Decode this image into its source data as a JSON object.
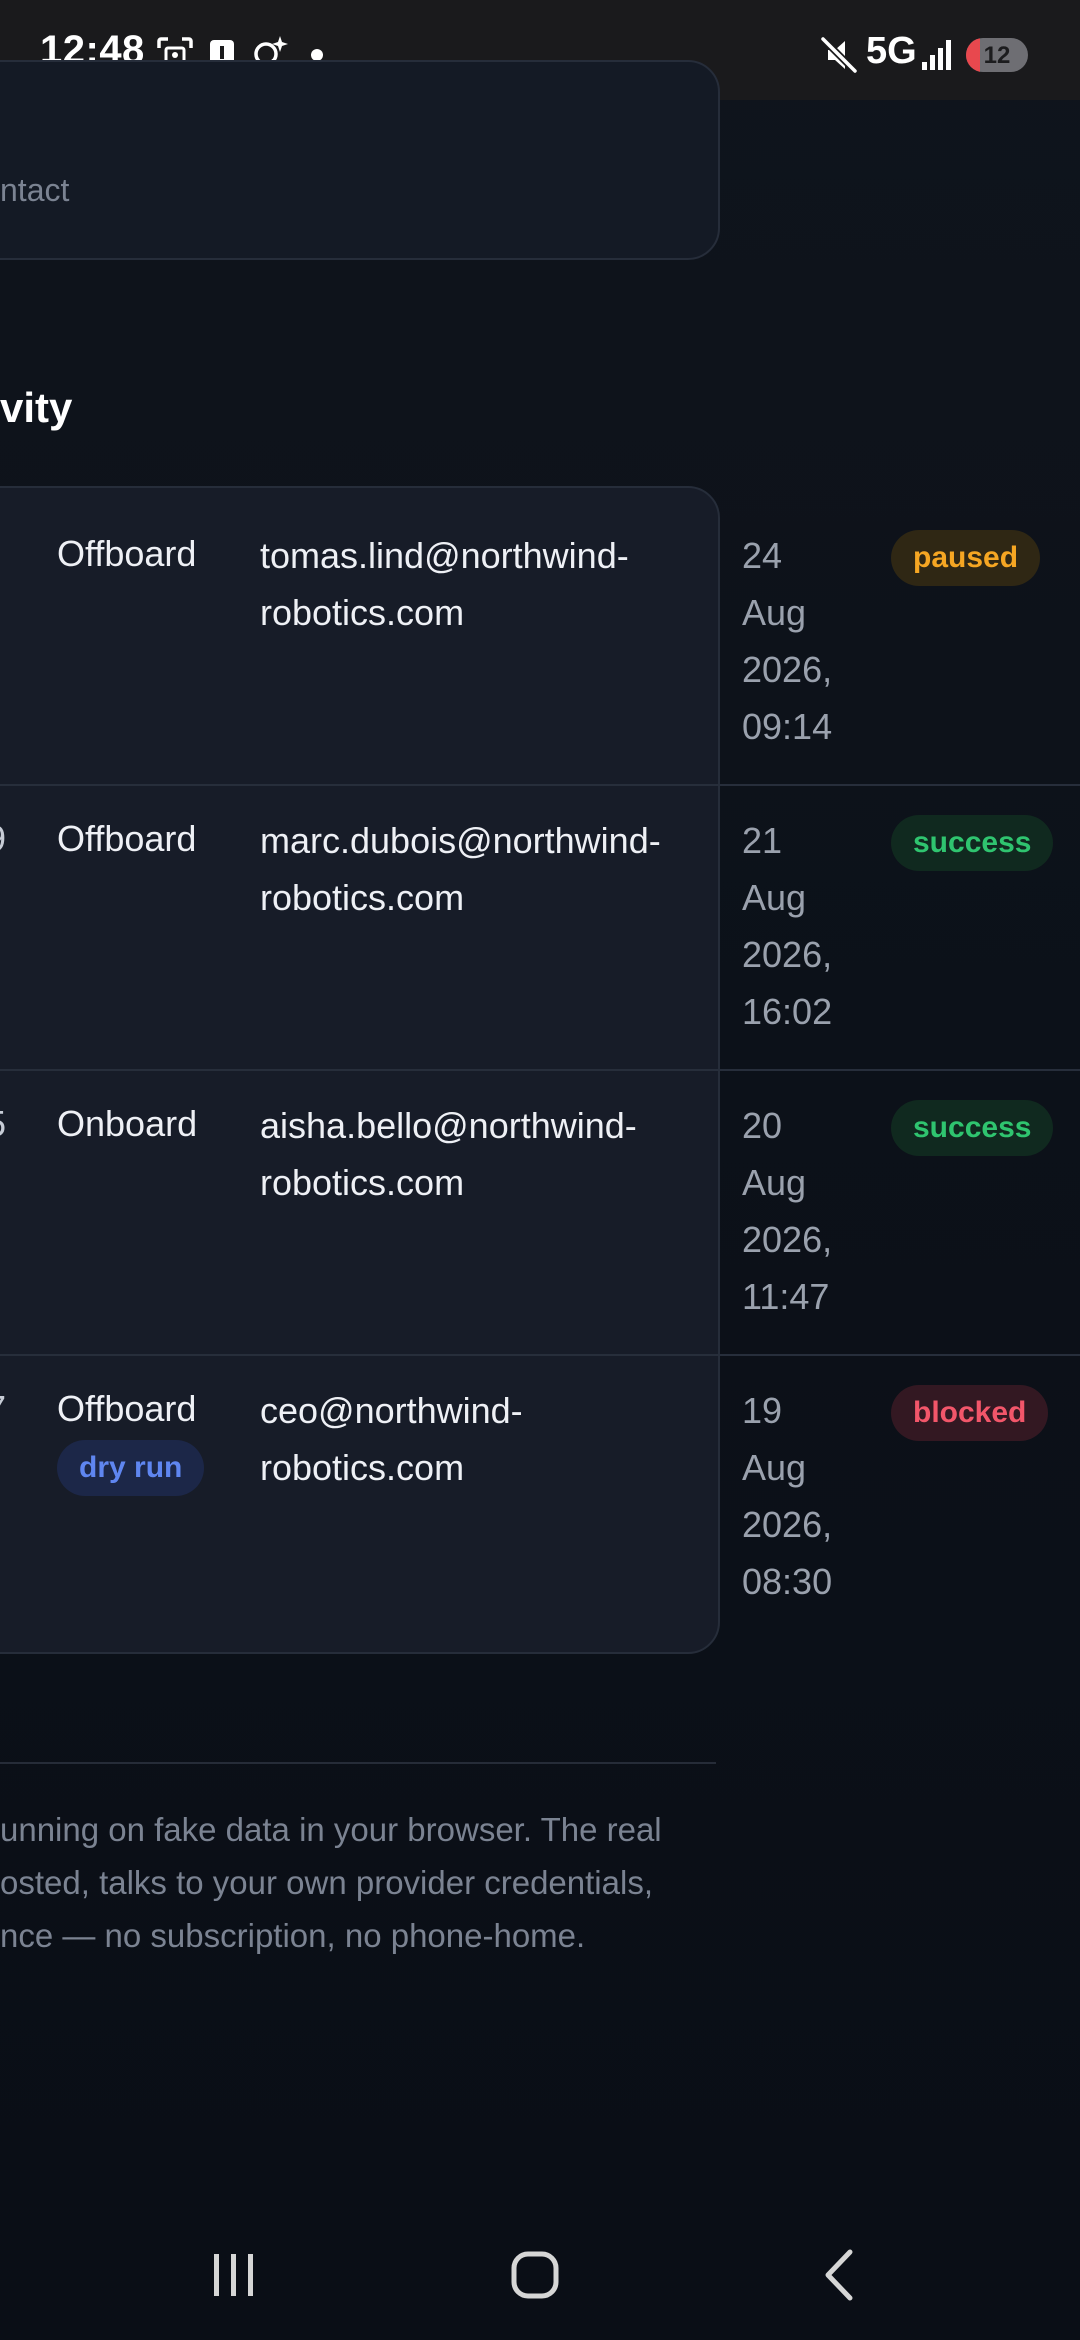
{
  "status_bar": {
    "time": "12:48",
    "network": "5G",
    "battery": "12",
    "icons": [
      "screenshot-icon",
      "alert-icon",
      "search-sparkle-icon",
      "notification-dot-icon",
      "mute-icon",
      "signal-icon"
    ]
  },
  "contact_card": {
    "text": "ntact"
  },
  "activity": {
    "heading": "vity",
    "rows": [
      {
        "num": "",
        "action": "Offboard",
        "email_line1": "tomas.lind@northwind-",
        "email_line2": "robotics.com",
        "date_day": "24",
        "date_month": "Aug",
        "date_year": "2026,",
        "date_time": "09:14",
        "status": "paused",
        "status_color": "#f5a623"
      },
      {
        "num": "9",
        "action": "Offboard",
        "email_line1": "marc.dubois@northwind-",
        "email_line2": "robotics.com",
        "date_day": "21",
        "date_month": "Aug",
        "date_year": "2026,",
        "date_time": "16:02",
        "status": "success",
        "status_color": "#2fc46f"
      },
      {
        "num": "5",
        "action": "Onboard",
        "email_line1": "aisha.bello@northwind-",
        "email_line2": "robotics.com",
        "date_day": "20",
        "date_month": "Aug",
        "date_year": "2026,",
        "date_time": "11:47",
        "status": "success",
        "status_color": "#2fc46f"
      },
      {
        "num": "7",
        "action": "Offboard",
        "dry_run": "dry run",
        "email_line1": "ceo@northwind-",
        "email_line2": "robotics.com",
        "date_day": "19",
        "date_month": "Aug",
        "date_year": "2026,",
        "date_time": "08:30",
        "status": "blocked",
        "status_color": "#f2566a"
      }
    ]
  },
  "footer": {
    "line1": "unning on fake data in your browser. The real",
    "line2": "osted, talks to your own provider credentials,",
    "line3": "nce — no subscription, no phone-home."
  },
  "nav_bar": {
    "buttons": [
      "recent-apps",
      "home",
      "back"
    ]
  }
}
